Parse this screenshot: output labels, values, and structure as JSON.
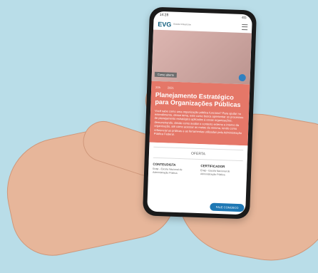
{
  "status": {
    "left": "14:28",
    "right": "4G"
  },
  "brand": {
    "mark": "EVG",
    "subtitle": "Escola Virtual.Gov"
  },
  "hero": {
    "tag": "Curso aberto"
  },
  "course": {
    "meta": [
      "20h",
      "2021"
    ],
    "title": "Planejamento Estratégico para Organizações Públicas",
    "description": "Você sabe como uma organização pública funciona? Para ajudar no entendimento, desse tema, este curso busca apresentar os processos de planejamento estratégico aplicados à essas organizações, demonstrando, desde como avaliar o contexto externo e interno da organização, até como acessar as metas da mesma, tendo como referencial as práticas e as ferramentas utilizadas pela Administração Pública Federal."
  },
  "offer": {
    "label": "OFERTA"
  },
  "columns": [
    {
      "heading": "CONTEUDISTA",
      "text": "Enap - Escola Nacional de Administração Pública"
    },
    {
      "heading": "CERTIFICADOR",
      "text": "Enap - Escola Nacional de Administração Pública"
    }
  ],
  "chat": {
    "label": "FALE CONOSCO"
  }
}
